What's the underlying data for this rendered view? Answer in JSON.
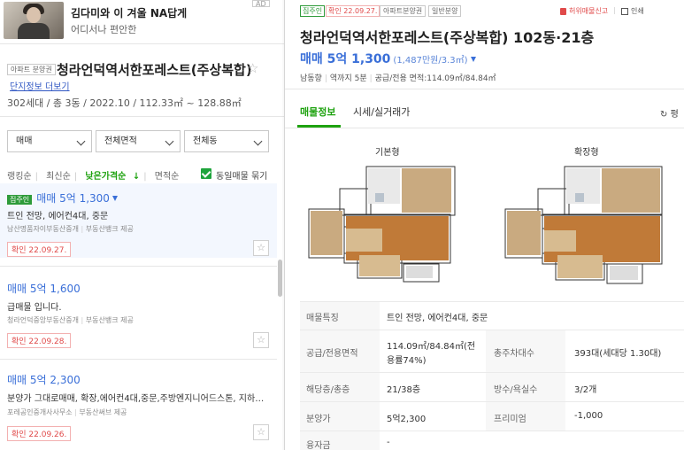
{
  "ad": {
    "title": "김다미와 이 겨울 NA답게",
    "subtitle": "어디서나 편안한",
    "badge": "AD"
  },
  "complex": {
    "type_tag": "아파트 분양권",
    "name": "청라언덕역서한포레스트(주상복합)",
    "info_link": "단지정보 더보기",
    "summary": "302세대 / 총 3동 / 2022.10 / 112.33㎡ ~ 128.88㎡"
  },
  "filters": [
    {
      "label": "매매"
    },
    {
      "label": "전체면적"
    },
    {
      "label": "전체동"
    }
  ],
  "sort": {
    "options": [
      "랭킹순",
      "최신순",
      "낮은가격순",
      "면적순"
    ],
    "active_index": 2,
    "same_listing_label": "동일매물 묶기",
    "same_listing_checked": true
  },
  "listings": [
    {
      "tag": "집주인",
      "price": "매매 5억 1,300",
      "price_down": true,
      "desc": "트인 전망, 에어컨4대, 중문",
      "agent": "남산명품자이부동산중개",
      "provider": "부동산뱅크 제공",
      "date": "확인 22.09.27.",
      "selected": true
    },
    {
      "tag": "",
      "price": "매매 5억 1,600",
      "price_down": false,
      "desc": "급매물 입니다.",
      "agent": "청라언덕중앙부동산중개",
      "provider": "부동산뱅크 제공",
      "date": "확인 22.09.28.",
      "selected": false
    },
    {
      "tag": "",
      "price": "매매 5억 2,300",
      "price_down": false,
      "desc": "분양가 그대로매매, 확장,에어컨4대,중문,주방엔지니어드스톤, 지하…",
      "agent": "포레공인중개사사무소",
      "provider": "부동산써브 제공",
      "date": "확인 22.09.26.",
      "selected": false
    }
  ],
  "detail": {
    "tags": {
      "owner": "집주인",
      "confirm": "확인 22.09.27.",
      "t1": "아파트분양권",
      "t2": "일반분양"
    },
    "report_label": "허위매물신고",
    "print_label": "인쇄",
    "title": "청라언덕역서한포레스트(주상복합) 102동·21층",
    "price": "매매 5억 1,300",
    "price_per_m2": "(1,487만원/3.3㎡)",
    "meta": [
      "남동향",
      "역까지 5분",
      "공급/전용 면적:114.09㎡/84.84㎡"
    ],
    "tabs": [
      "매물정보",
      "시세/실거래가"
    ],
    "active_tab": 0,
    "refresh_label": "평",
    "floorplans": [
      "기본형",
      "확장형"
    ]
  },
  "specs": [
    {
      "k1": "매물특징",
      "v1": "트인 전망, 에어컨4대, 중문",
      "k2": "",
      "v2": ""
    },
    {
      "k1": "공급/전용면적",
      "v1a": "114.09㎡/84.84㎡(전",
      "v1b": "용률74%)",
      "k2": "총주차대수",
      "v2": "393대(세대당 1.30대)"
    },
    {
      "k1": "해당층/총층",
      "v1": "21/38층",
      "k2": "방수/욕실수",
      "v2": "3/2개"
    },
    {
      "k1": "분양가",
      "v1": "5억2,300",
      "k2": "프리미엄",
      "v2": "-1,000"
    },
    {
      "k1": "융자금",
      "v1": "-",
      "k2": "",
      "v2": ""
    }
  ],
  "colors": {
    "accent_green": "#1ea20f",
    "price_blue": "#3a6fd8",
    "date_red": "#e04a4a"
  }
}
